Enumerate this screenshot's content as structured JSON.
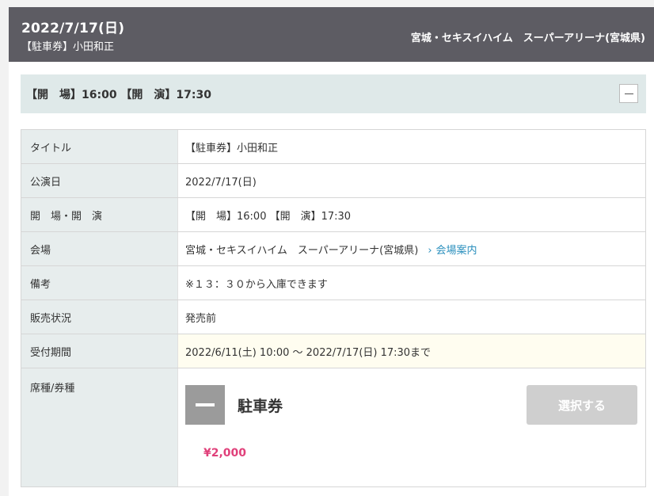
{
  "header": {
    "date": "2022/7/17(日)",
    "subtitle": "【駐車券】小田和正",
    "venue": "宮城・セキスイハイム　スーパーアリーナ(宮城県)"
  },
  "open_bar": {
    "text": "【開　場】16:00 【開　演】17:30"
  },
  "info_rows": [
    {
      "label": "タイトル",
      "value": "【駐車券】小田和正"
    },
    {
      "label": "公演日",
      "value": "2022/7/17(日)"
    },
    {
      "label": "開　場・開　演",
      "value": "【開　場】16:00 【開　演】17:30"
    },
    {
      "label": "会場",
      "value": "宮城・セキスイハイム　スーパーアリーナ(宮城県)",
      "link": "会場案内"
    },
    {
      "label": "備考",
      "value": "※１３：３０から入庫できます"
    },
    {
      "label": "販売状況",
      "value": "発売前"
    },
    {
      "label": "受付期間",
      "value": "2022/6/11(土) 10:00 ～ 2022/7/17(日) 17:30まで"
    },
    {
      "label": "席種/券種"
    }
  ],
  "seat": {
    "name": "駐車券",
    "select_label": "選択する",
    "price": "¥2,000"
  },
  "colors": {
    "header_bg": "#5d5c63",
    "label_bg": "#e7eded",
    "accent_price": "#e0407a",
    "link": "#2a8fbd"
  }
}
